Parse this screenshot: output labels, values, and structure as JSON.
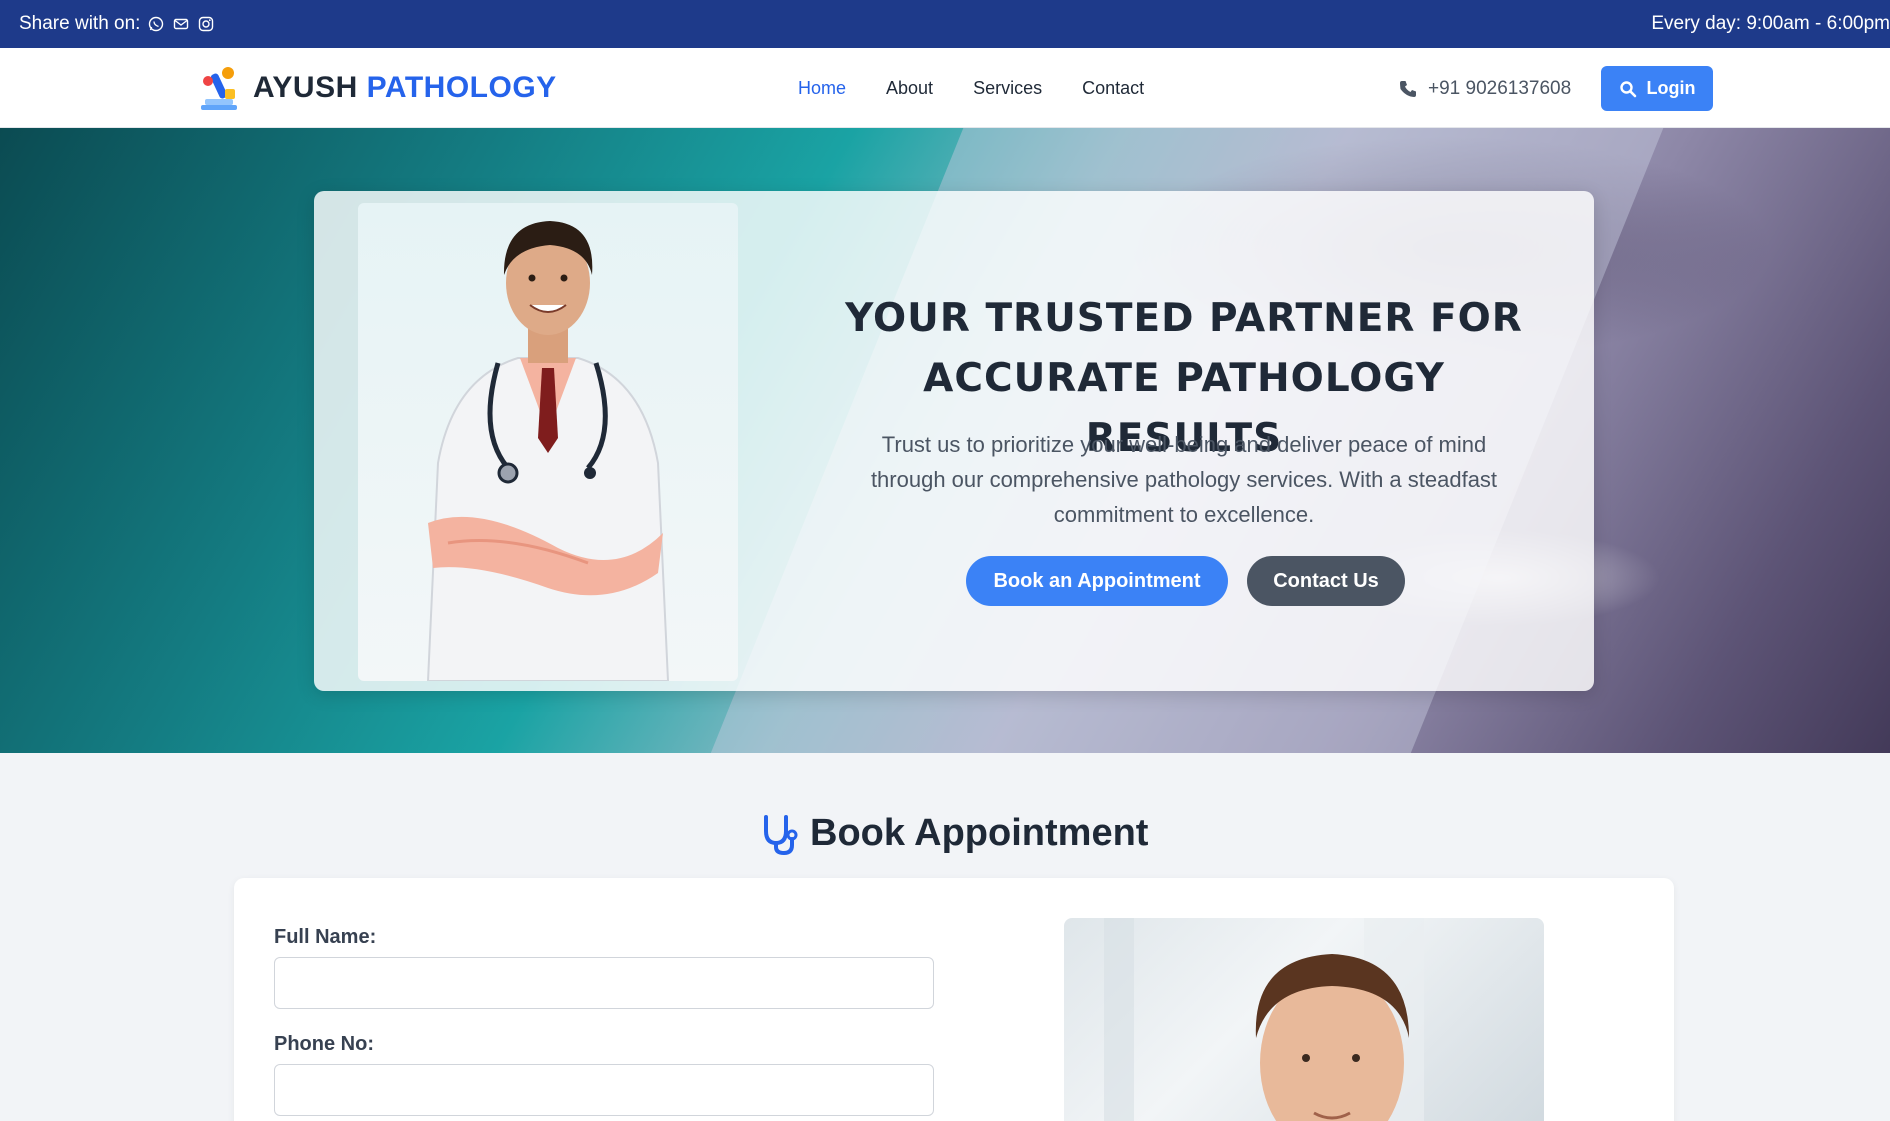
{
  "topbar": {
    "share_label": "Share with on:",
    "share_icons": [
      "whatsapp-icon",
      "mail-icon",
      "instagram-icon"
    ],
    "hours": "Every day: 9:00am - 6:00pm"
  },
  "brand": {
    "part1": "AYUSH",
    "part2": "PATHOLOGY"
  },
  "nav": {
    "items": [
      {
        "label": "Home",
        "active": true
      },
      {
        "label": "About",
        "active": false
      },
      {
        "label": "Services",
        "active": false
      },
      {
        "label": "Contact",
        "active": false
      }
    ]
  },
  "contact": {
    "phone": "+91 9026137608"
  },
  "login": {
    "label": "Login"
  },
  "hero": {
    "title_line1": "YOUR TRUSTED PARTNER FOR",
    "title_line2": "ACCURATE PATHOLOGY RESULTS",
    "description": "Trust us to prioritize your well-being and deliver peace of mind through our comprehensive pathology services. With a steadfast commitment to excellence.",
    "primary_button": "Book an Appointment",
    "secondary_button": "Contact Us"
  },
  "appointment": {
    "title": "Book Appointment",
    "fields": [
      {
        "label": "Full Name:",
        "value": ""
      },
      {
        "label": "Phone No:",
        "value": ""
      }
    ]
  },
  "colors": {
    "topbar": "#1e3a8a",
    "accent": "#3b82f6",
    "brand_blue": "#2563eb",
    "secondary_button": "#4b5563"
  }
}
